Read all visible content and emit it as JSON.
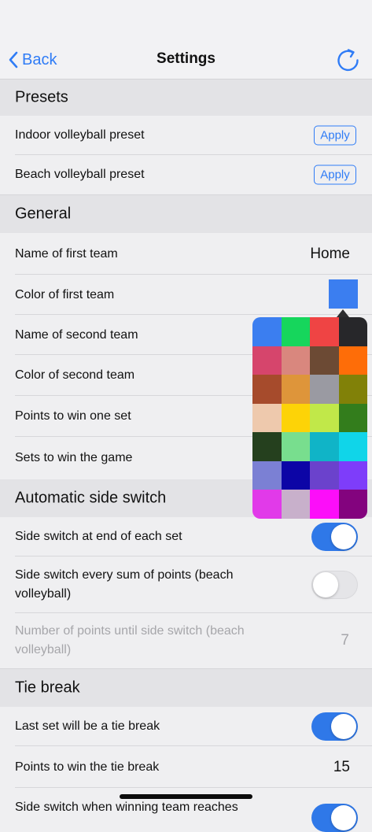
{
  "nav": {
    "back_label": "Back",
    "title": "Settings"
  },
  "sections": {
    "presets": "Presets",
    "general": "General",
    "auto_switch": "Automatic side switch",
    "tie_break": "Tie break"
  },
  "presets": {
    "indoor_label": "Indoor volleyball preset",
    "beach_label": "Beach volleyball preset",
    "apply_label": "Apply"
  },
  "general": {
    "first_team_name_label": "Name of first team",
    "first_team_name_value": "Home",
    "first_team_color_label": "Color of first team",
    "first_team_color": "#3b7ef0",
    "second_team_name_label": "Name of second team",
    "second_team_color_label": "Color of second team",
    "points_to_win_set_label": "Points to win one set",
    "sets_to_win_game_label": "Sets to win the game"
  },
  "auto_switch": {
    "end_of_set_label": "Side switch at end of each set",
    "end_of_set_on": true,
    "sum_points_label": "Side switch every sum of points (beach volleyball)",
    "sum_points_on": false,
    "points_until_label": "Number of points until side switch (beach volleyball)",
    "points_until_value": "7"
  },
  "tie_break": {
    "last_set_label": "Last set will be a tie break",
    "last_set_on": true,
    "points_label": "Points to win the tie break",
    "points_value": "15",
    "switch_label": "Side switch when winning team reaches"
  },
  "palette_colors": [
    "#3b7ef0",
    "#16d65c",
    "#ef4444",
    "#27272a",
    "#d6456c",
    "#d9877e",
    "#6c4a34",
    "#fe6d08",
    "#a64b2c",
    "#de953a",
    "#9a9aa2",
    "#818108",
    "#eec9ad",
    "#fdd307",
    "#c1e849",
    "#337d1c",
    "#25401e",
    "#78de8e",
    "#10b4c7",
    "#10d5e9",
    "#7b80d4",
    "#0c05a6",
    "#6b42cc",
    "#7e3dfa",
    "#e13ae9",
    "#c8b0cb",
    "#fc0ef9",
    "#83037e"
  ]
}
